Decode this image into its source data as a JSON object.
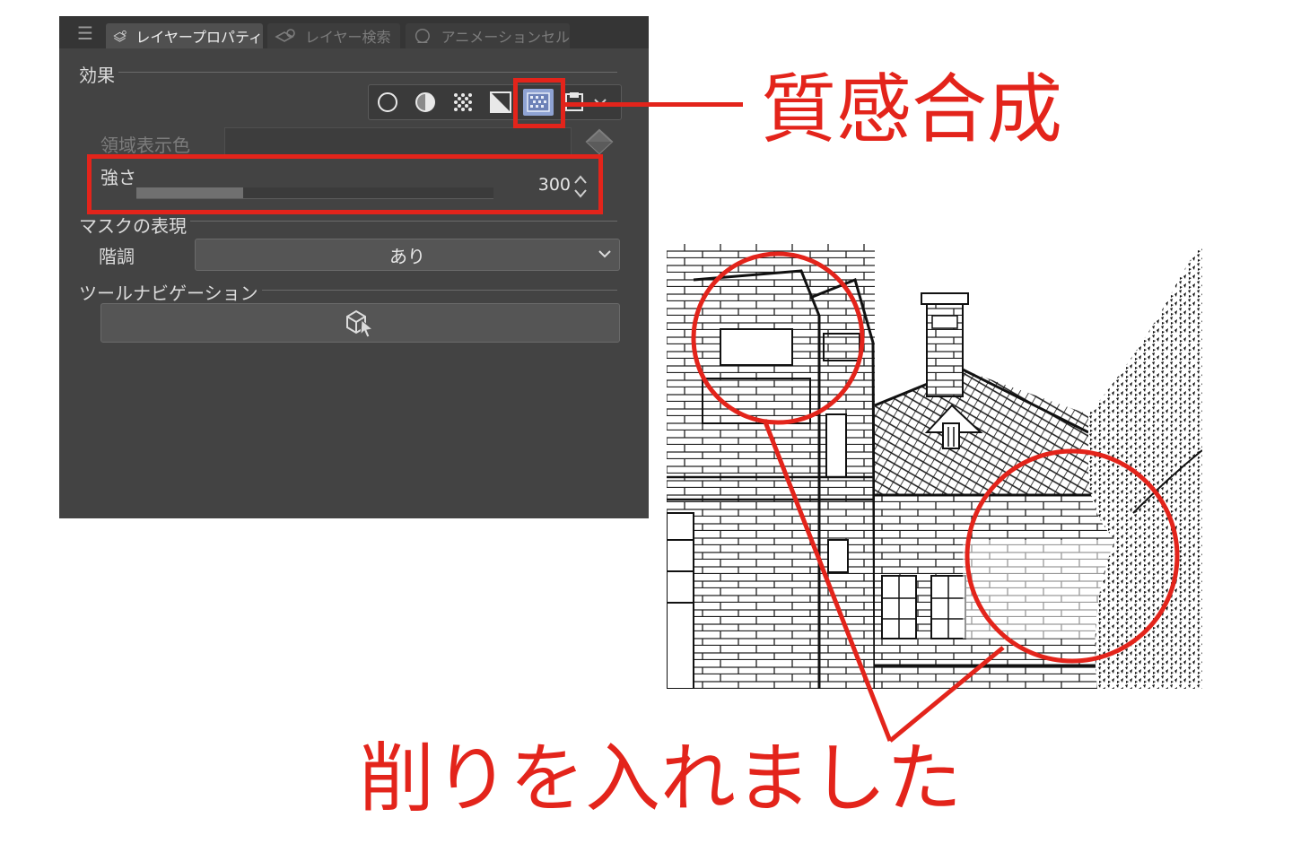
{
  "panel": {
    "tabs": [
      {
        "label": "レイヤープロパティ",
        "active": true
      },
      {
        "label": "レイヤー検索",
        "active": false
      },
      {
        "label": "アニメーションセル",
        "active": false
      }
    ],
    "sections": {
      "effect": "効果",
      "mask": "マスクの表現",
      "tool_nav": "ツールナビゲーション"
    },
    "effect_buttons": [
      "border-effect-icon",
      "layer-color-icon",
      "tone-icon",
      "threshold-icon",
      "texture-composite-icon",
      "more-effects-icon"
    ],
    "region_color_label": "領域表示色",
    "strength": {
      "label": "強さ",
      "value": "300",
      "slider_fraction": 0.3
    },
    "gradation": {
      "label": "階調",
      "value": "あり"
    }
  },
  "annotations": {
    "texture_label": "質感合成",
    "scraping_label": "削りを入れました"
  },
  "colors": {
    "panel_bg": "#434343",
    "accent_red": "#e3241b",
    "selected_button": "#8fa3d3"
  }
}
